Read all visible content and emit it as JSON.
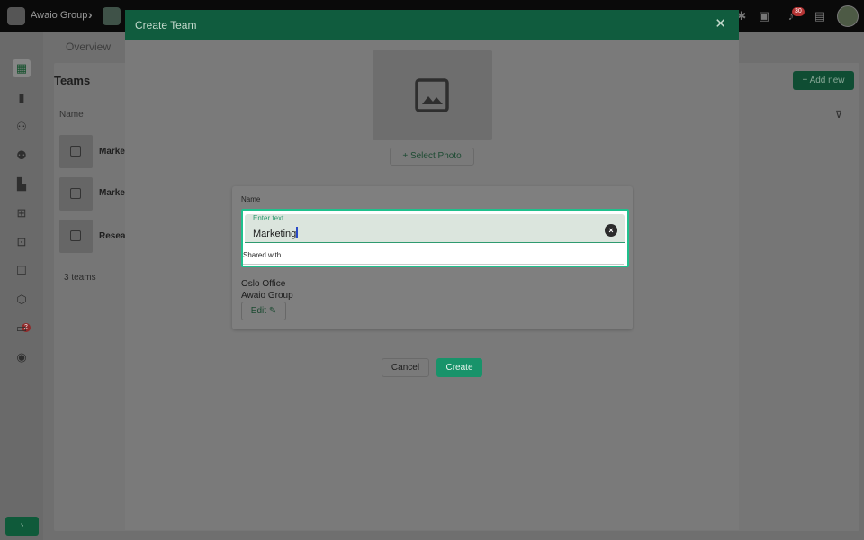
{
  "topbar": {
    "org_name": "Awaio Group",
    "notification_count": "30"
  },
  "sidebar": {
    "items": [
      {
        "icon": "dashboard-icon",
        "glyph": "▦"
      },
      {
        "icon": "bar-chart-icon",
        "glyph": "▮"
      },
      {
        "icon": "users-icon",
        "glyph": "⚇"
      },
      {
        "icon": "groups-icon",
        "glyph": "⚉"
      },
      {
        "icon": "building-icon",
        "glyph": "▙"
      },
      {
        "icon": "apps-icon",
        "glyph": "⊞"
      },
      {
        "icon": "lock-icon",
        "glyph": "⊡"
      },
      {
        "icon": "chat-icon",
        "glyph": "☐"
      },
      {
        "icon": "box-icon",
        "glyph": "⬡"
      },
      {
        "icon": "money-icon",
        "glyph": "▭"
      },
      {
        "icon": "broadcast-icon",
        "glyph": "◉"
      }
    ],
    "box_badge": "2",
    "expand_glyph": "›"
  },
  "background": {
    "tab": "Overview",
    "title": "Teams",
    "column_header": "Name",
    "rows": [
      "Marke",
      "Marke",
      "Resea"
    ],
    "count": "3 teams",
    "add_button": "+ Add new"
  },
  "modal": {
    "title": "Create Team",
    "close_glyph": "✕",
    "select_photo": "+ Select Photo",
    "name_label": "Name",
    "name_input": {
      "floating_label": "Enter text",
      "value": "Marketing"
    },
    "shared_with_label": "Shared with",
    "shared_with": [
      "Oslo Office",
      "Awaio Group"
    ],
    "edit_button": "Edit",
    "cancel_button": "Cancel",
    "create_button": "Create"
  },
  "colors": {
    "accent": "#1fc08c",
    "primary_button": "#18936a",
    "modal_header": "#105c3e"
  }
}
